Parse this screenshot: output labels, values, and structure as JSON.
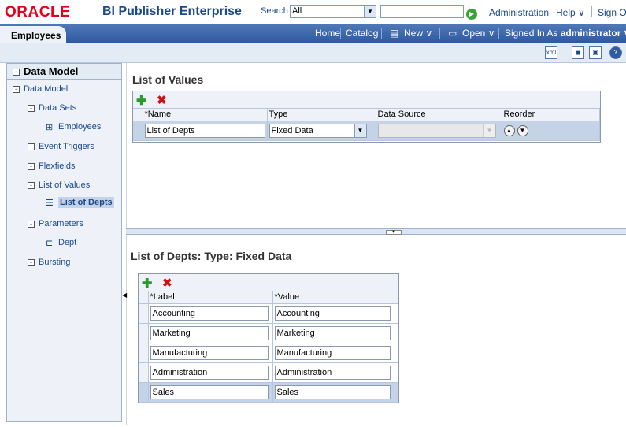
{
  "header": {
    "logo": "ORACLE",
    "product": "BI Publisher Enterprise",
    "search_label": "Search",
    "search_scope": "All",
    "search_value": "",
    "links": [
      "Administration",
      "Help ∨",
      "Sign Out"
    ]
  },
  "nav": {
    "doc_tab": "Employees",
    "links": [
      "Home",
      "Catalog",
      "New ∨",
      "Open ∨"
    ],
    "signed_in_label": "Signed In As",
    "user": "administrator ∨"
  },
  "tree": {
    "title": "Data Model",
    "items": [
      "Data Model",
      "Data Sets",
      "Employees",
      "Event Triggers",
      "Flexfields",
      "List of Values",
      "List of Depts",
      "Parameters",
      "Dept",
      "Bursting"
    ]
  },
  "lov": {
    "title": "List of Values",
    "columns": [
      "*Name",
      "Type",
      "Data Source",
      "Reorder"
    ],
    "rows": [
      {
        "name": "List of Depts",
        "type": "Fixed Data",
        "data_source": ""
      }
    ]
  },
  "fixed": {
    "title": "List of Depts: Type: Fixed Data",
    "columns": [
      "*Label",
      "*Value"
    ],
    "rows": [
      {
        "label": "Accounting",
        "value": "Accounting"
      },
      {
        "label": "Marketing",
        "value": "Marketing"
      },
      {
        "label": "Manufacturing",
        "value": "Manufacturing"
      },
      {
        "label": "Administration",
        "value": "Administration"
      },
      {
        "label": "Sales",
        "value": "Sales"
      }
    ]
  }
}
